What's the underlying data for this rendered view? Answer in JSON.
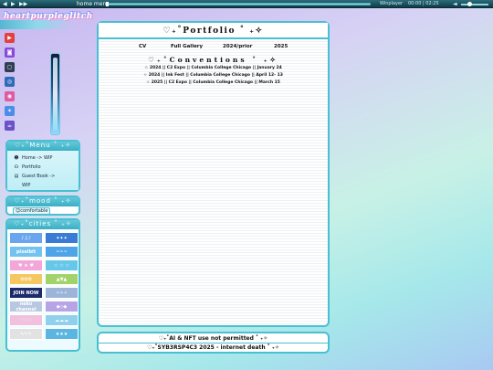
{
  "player": {
    "controls": [
      "◀",
      "▶",
      "▶▶"
    ],
    "track_title": "home men",
    "progress": 0.0,
    "player_name": "Winplayer",
    "time_elapsed": "00:00",
    "time_total": "02:25",
    "volume_icon": "speaker-icon"
  },
  "logo": {
    "text": "heartpurpleglitch"
  },
  "socials": [
    {
      "name": "youtube-icon",
      "glyph": "▶",
      "color": "#e0433f"
    },
    {
      "name": "twitch-icon",
      "glyph": "◙",
      "color": "#8a4ad9"
    },
    {
      "name": "square-icon",
      "glyph": "◻",
      "color": "#2f3e52"
    },
    {
      "name": "camera-icon",
      "glyph": "◎",
      "color": "#2e6bb8"
    },
    {
      "name": "instagram-icon",
      "glyph": "◉",
      "color": "#e05aa3"
    },
    {
      "name": "bluesky-icon",
      "glyph": "✶",
      "color": "#4b8ee8"
    },
    {
      "name": "kofi-icon",
      "glyph": "☕",
      "color": "#6a52c9"
    }
  ],
  "menu": {
    "title": "♡₊˚Menu ˚ ₊✧",
    "items": [
      {
        "icon": "☻",
        "label": "Home -> WIP"
      },
      {
        "icon": "☊",
        "label": "Portfolio"
      },
      {
        "icon": "▤",
        "label": "Guest Book ->"
      },
      {
        "icon": "",
        "label": "WIP"
      }
    ]
  },
  "mood": {
    "title": "♡₊˚mood ˚ ₊✧",
    "value": "comfortable"
  },
  "cities": {
    "title": "♡₊˚cities ˚ ₊✧",
    "badges": [
      {
        "text": "♪♫♪",
        "color": "#6aa6f0"
      },
      {
        "text": "✦✦✦",
        "color": "#3a7bd5"
      },
      {
        "text": "pixelbit",
        "color": "#74c2f0"
      },
      {
        "text": "~~~",
        "color": "#4fa4e8"
      },
      {
        "text": "♥ ★ ♥",
        "color": "#f2a7d8"
      },
      {
        "text": "☆ ☆ ☆",
        "color": "#67c7e8"
      },
      {
        "text": "✿✿✿",
        "color": "#f5c760"
      },
      {
        "text": "▲▼▲",
        "color": "#a2d36b"
      },
      {
        "text": "JOIN NOW",
        "color": "#1c2c6b"
      },
      {
        "text": "✧✧✧",
        "color": "#9cb4d8"
      },
      {
        "text": "neko channel",
        "color": "#b8c8e0"
      },
      {
        "text": "◆◇◆",
        "color": "#b6a4e6"
      },
      {
        "text": "♡♡♡",
        "color": "#f0c0dc"
      },
      {
        "text": "☁☁☁",
        "color": "#8fd0ec"
      },
      {
        "text": "✎✎✎",
        "color": "#e2e2e2"
      },
      {
        "text": "★★★",
        "color": "#5ab6e0"
      }
    ]
  },
  "main": {
    "title": "♡₊˚Portfolio ˚ ₊✧",
    "tabs": [
      "CV",
      "Full Gallery",
      "2024/prior",
      "2025"
    ],
    "conventions_title": "♡₊˚Conventions ˚ ₊✧",
    "entries": [
      "☆ 2024 || C2 Expo || Columbia College Chicago || January 24",
      "☆ 2024 || Ink Fest || Columbia College Chicago || April 12- 13",
      "☆ 2025 || C2 Expo || Columbia College Chicago || March 15"
    ]
  },
  "footer": {
    "line1": "♡₊˚AI & NFT use not permitted ˚ ₊✧",
    "line2": "♡₊˚SYB3RSP4C3 2025 - internet death ˚ ₊✧"
  }
}
